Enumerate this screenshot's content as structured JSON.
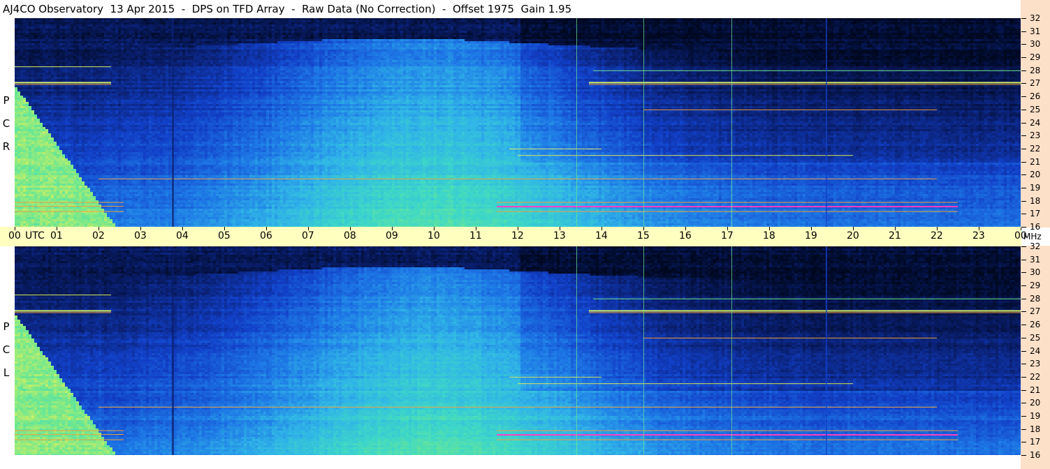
{
  "title": "AJ4CO Observatory  13 Apr 2015  -  DPS on TFD Array  -  Raw Data (No Correction)  -  Offset 1975  Gain 1.95",
  "panels": [
    {
      "label_letters": [
        "P",
        "C",
        "R"
      ]
    },
    {
      "label_letters": [
        "P",
        "C",
        "L"
      ]
    }
  ],
  "time_axis": {
    "labels": [
      "00",
      "01",
      "02",
      "03",
      "04",
      "05",
      "06",
      "07",
      "08",
      "09",
      "10",
      "11",
      "12",
      "13",
      "14",
      "15",
      "16",
      "17",
      "18",
      "19",
      "20",
      "21",
      "22",
      "23",
      "00"
    ],
    "utc_label": "UTC",
    "mhz_label": "MHz"
  },
  "chart_data": [
    {
      "type": "heatmap",
      "title": "R C P",
      "xlabel": "UTC",
      "ylabel": "MHz",
      "xlim": [
        0,
        24
      ],
      "ylim": [
        16,
        32
      ],
      "x_ticks": [
        "00",
        "01",
        "02",
        "03",
        "04",
        "05",
        "06",
        "07",
        "08",
        "09",
        "10",
        "11",
        "12",
        "13",
        "14",
        "15",
        "16",
        "17",
        "18",
        "19",
        "20",
        "21",
        "22",
        "23",
        "00"
      ],
      "y_ticks": [
        16,
        17,
        18,
        19,
        20,
        21,
        22,
        23,
        24,
        25,
        26,
        27,
        28,
        29,
        30,
        31,
        32
      ],
      "colormap": [
        "#000820",
        "#0a1f6e",
        "#1240c8",
        "#1e78e6",
        "#30b4e8",
        "#3ed8c8",
        "#6ee890",
        "#d8f060",
        "#f0a040",
        "#ff40c0"
      ],
      "features": {
        "solar_burst_bands_mhz": [
          17.2,
          17.6,
          17.9,
          27.0
        ],
        "strong_interference_window_utc": [
          11.5,
          22.5
        ],
        "dark_high_freq_band_mhz": [
          29.5,
          32
        ]
      }
    },
    {
      "type": "heatmap",
      "title": "L C P",
      "xlabel": "UTC",
      "ylabel": "MHz",
      "xlim": [
        0,
        24
      ],
      "ylim": [
        16,
        32
      ],
      "x_ticks": [
        "00",
        "01",
        "02",
        "03",
        "04",
        "05",
        "06",
        "07",
        "08",
        "09",
        "10",
        "11",
        "12",
        "13",
        "14",
        "15",
        "16",
        "17",
        "18",
        "19",
        "20",
        "21",
        "22",
        "23",
        "00"
      ],
      "y_ticks": [
        16,
        17,
        18,
        19,
        20,
        21,
        22,
        23,
        24,
        25,
        26,
        27,
        28,
        29,
        30,
        31,
        32
      ],
      "colormap": [
        "#000820",
        "#0a1f6e",
        "#1240c8",
        "#1e78e6",
        "#30b4e8",
        "#3ed8c8",
        "#6ee890",
        "#d8f060",
        "#f0a040",
        "#ff40c0"
      ],
      "features": {
        "solar_burst_bands_mhz": [
          17.2,
          17.6,
          17.9,
          27.0
        ],
        "strong_interference_window_utc": [
          11.5,
          22.5
        ],
        "dark_high_freq_band_mhz": [
          29.5,
          32
        ]
      }
    }
  ]
}
